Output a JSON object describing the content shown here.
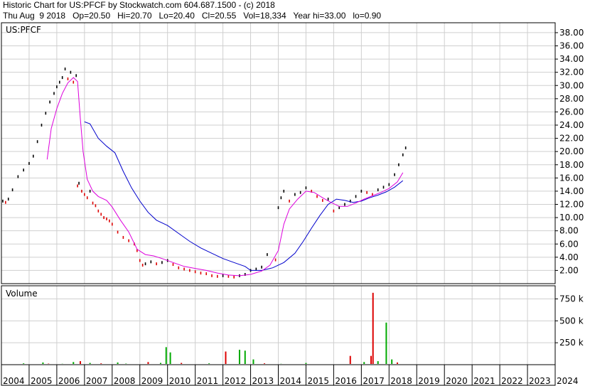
{
  "header": {
    "line1": "Historic Chart for US:PFCF by Stockwatch.com 604.687.1500 - (c) 2018",
    "line2": "Thu Aug  9 2018   Op=20.50   Hi=20.70   Lo=20.40   Cl=20.55   Vol=18,334   Year hi=33.00   lo=0.90"
  },
  "price_panel": {
    "symbol_label": "US:PFCF"
  },
  "volume_panel": {
    "title": "Volume"
  },
  "colors": {
    "bar_up": "#000000",
    "bar_down": "#dd0000",
    "ma_short": "#dd00dd",
    "ma_long": "#0000cc",
    "vol_up": "#00aa00",
    "vol_down": "#dd0000",
    "grid": "#cfcfcf",
    "frame": "#000000"
  },
  "chart_data": [
    {
      "type": "line",
      "panel": "price",
      "y_ticks": [
        "2.00",
        "4.00",
        "6.00",
        "8.00",
        "10.00",
        "12.00",
        "14.00",
        "16.00",
        "18.00",
        "20.00",
        "22.00",
        "24.00",
        "26.00",
        "28.00",
        "30.00",
        "32.00",
        "34.00",
        "36.00",
        "38.00"
      ],
      "ylim": [
        0,
        39.5
      ],
      "x_ticks": [
        "2004",
        "2005",
        "2006",
        "2007",
        "2008",
        "2009",
        "2010",
        "2011",
        "2012",
        "2013",
        "2014",
        "2015",
        "2016",
        "2017",
        "2018",
        "2019",
        "2020",
        "2021",
        "2022",
        "2023",
        "2024"
      ],
      "xlim": [
        2004.0,
        2024.0
      ],
      "price_points": [
        [
          2004.05,
          12.5
        ],
        [
          2004.15,
          12.3
        ],
        [
          2004.25,
          12.8
        ],
        [
          2004.4,
          14.2
        ],
        [
          2004.6,
          16.2
        ],
        [
          2004.8,
          17.2
        ],
        [
          2005.0,
          18.2
        ],
        [
          2005.15,
          19.3
        ],
        [
          2005.3,
          21.5
        ],
        [
          2005.45,
          24.0
        ],
        [
          2005.6,
          25.8
        ],
        [
          2005.75,
          27.5
        ],
        [
          2005.9,
          28.8
        ],
        [
          2006.0,
          29.8
        ],
        [
          2006.1,
          30.5
        ],
        [
          2006.2,
          31.2
        ],
        [
          2006.3,
          32.5
        ],
        [
          2006.4,
          31.0
        ],
        [
          2006.5,
          32.0
        ],
        [
          2006.6,
          30.5
        ],
        [
          2006.7,
          31.5
        ],
        [
          2006.75,
          14.8
        ],
        [
          2006.8,
          15.2
        ],
        [
          2006.9,
          14.0
        ],
        [
          2007.0,
          13.5
        ],
        [
          2007.1,
          13.0
        ],
        [
          2007.2,
          14.0
        ],
        [
          2007.3,
          12.2
        ],
        [
          2007.4,
          11.8
        ],
        [
          2007.5,
          11.0
        ],
        [
          2007.6,
          10.5
        ],
        [
          2007.7,
          10.0
        ],
        [
          2007.8,
          9.8
        ],
        [
          2007.9,
          9.5
        ],
        [
          2008.0,
          9.0
        ],
        [
          2008.2,
          7.8
        ],
        [
          2008.4,
          7.0
        ],
        [
          2008.6,
          6.5
        ],
        [
          2008.8,
          6.0
        ],
        [
          2008.9,
          5.0
        ],
        [
          2009.0,
          3.5
        ],
        [
          2009.1,
          2.8
        ],
        [
          2009.2,
          3.0
        ],
        [
          2009.4,
          3.3
        ],
        [
          2009.6,
          3.0
        ],
        [
          2009.8,
          3.2
        ],
        [
          2010.0,
          3.5
        ],
        [
          2010.2,
          2.9
        ],
        [
          2010.4,
          2.4
        ],
        [
          2010.6,
          2.2
        ],
        [
          2010.8,
          2.0
        ],
        [
          2011.0,
          1.8
        ],
        [
          2011.2,
          1.6
        ],
        [
          2011.4,
          1.5
        ],
        [
          2011.6,
          1.2
        ],
        [
          2011.8,
          1.1
        ],
        [
          2012.0,
          1.2
        ],
        [
          2012.2,
          1.1
        ],
        [
          2012.4,
          1.0
        ],
        [
          2012.6,
          1.2
        ],
        [
          2012.8,
          1.4
        ],
        [
          2013.0,
          2.0
        ],
        [
          2013.2,
          2.2
        ],
        [
          2013.4,
          2.5
        ],
        [
          2013.6,
          4.4
        ],
        [
          2013.9,
          3.6
        ],
        [
          2014.0,
          11.5
        ],
        [
          2014.1,
          13.0
        ],
        [
          2014.2,
          14.0
        ],
        [
          2014.4,
          12.5
        ],
        [
          2014.6,
          13.5
        ],
        [
          2014.8,
          13.8
        ],
        [
          2015.0,
          14.5
        ],
        [
          2015.2,
          14.0
        ],
        [
          2015.4,
          13.2
        ],
        [
          2015.6,
          12.6
        ],
        [
          2015.8,
          12.8
        ],
        [
          2016.0,
          11.0
        ],
        [
          2016.2,
          11.5
        ],
        [
          2016.4,
          12.0
        ],
        [
          2016.6,
          12.5
        ],
        [
          2016.8,
          13.2
        ],
        [
          2017.0,
          14.0
        ],
        [
          2017.2,
          13.8
        ],
        [
          2017.4,
          13.5
        ],
        [
          2017.6,
          14.2
        ],
        [
          2017.8,
          14.6
        ],
        [
          2018.0,
          15.0
        ],
        [
          2018.2,
          16.5
        ],
        [
          2018.35,
          18.0
        ],
        [
          2018.5,
          19.5
        ],
        [
          2018.6,
          20.55
        ]
      ],
      "ma_short": [
        [
          2005.65,
          18.8
        ],
        [
          2005.8,
          23.5
        ],
        [
          2006.0,
          26.5
        ],
        [
          2006.2,
          28.8
        ],
        [
          2006.4,
          30.4
        ],
        [
          2006.6,
          31.2
        ],
        [
          2006.75,
          30.6
        ],
        [
          2006.85,
          25.0
        ],
        [
          2006.95,
          20.0
        ],
        [
          2007.1,
          15.8
        ],
        [
          2007.3,
          14.0
        ],
        [
          2007.5,
          13.2
        ],
        [
          2007.8,
          12.6
        ],
        [
          2008.0,
          11.6
        ],
        [
          2008.3,
          9.6
        ],
        [
          2008.6,
          7.8
        ],
        [
          2008.9,
          5.2
        ],
        [
          2009.2,
          4.4
        ],
        [
          2009.5,
          4.2
        ],
        [
          2009.8,
          3.8
        ],
        [
          2010.2,
          3.2
        ],
        [
          2010.6,
          2.6
        ],
        [
          2011.0,
          2.3
        ],
        [
          2011.4,
          2.0
        ],
        [
          2011.8,
          1.6
        ],
        [
          2012.2,
          1.3
        ],
        [
          2012.6,
          1.2
        ],
        [
          2013.0,
          1.4
        ],
        [
          2013.4,
          1.9
        ],
        [
          2013.7,
          2.8
        ],
        [
          2014.0,
          5.0
        ],
        [
          2014.2,
          9.0
        ],
        [
          2014.4,
          11.3
        ],
        [
          2014.7,
          12.8
        ],
        [
          2015.0,
          14.0
        ],
        [
          2015.3,
          13.8
        ],
        [
          2015.6,
          13.0
        ],
        [
          2015.9,
          12.3
        ],
        [
          2016.2,
          11.7
        ],
        [
          2016.5,
          11.7
        ],
        [
          2016.8,
          12.2
        ],
        [
          2017.1,
          12.8
        ],
        [
          2017.4,
          13.3
        ],
        [
          2017.7,
          13.8
        ],
        [
          2018.0,
          14.4
        ],
        [
          2018.3,
          15.4
        ],
        [
          2018.5,
          16.8
        ]
      ],
      "ma_long": [
        [
          2007.0,
          24.5
        ],
        [
          2007.2,
          24.2
        ],
        [
          2007.5,
          22.0
        ],
        [
          2007.8,
          20.8
        ],
        [
          2008.1,
          19.8
        ],
        [
          2008.4,
          17.0
        ],
        [
          2008.7,
          14.5
        ],
        [
          2009.0,
          12.5
        ],
        [
          2009.3,
          10.8
        ],
        [
          2009.6,
          9.6
        ],
        [
          2010.0,
          8.8
        ],
        [
          2010.4,
          7.6
        ],
        [
          2010.8,
          6.4
        ],
        [
          2011.2,
          5.4
        ],
        [
          2011.6,
          4.6
        ],
        [
          2012.0,
          3.8
        ],
        [
          2012.4,
          3.2
        ],
        [
          2012.8,
          2.6
        ],
        [
          2013.0,
          2.0
        ],
        [
          2013.4,
          2.0
        ],
        [
          2013.8,
          2.4
        ],
        [
          2014.2,
          3.2
        ],
        [
          2014.6,
          4.6
        ],
        [
          2014.9,
          6.4
        ],
        [
          2015.2,
          8.4
        ],
        [
          2015.5,
          10.3
        ],
        [
          2015.8,
          12.0
        ],
        [
          2016.1,
          12.8
        ],
        [
          2016.4,
          12.6
        ],
        [
          2016.7,
          12.3
        ],
        [
          2017.0,
          12.5
        ],
        [
          2017.3,
          13.0
        ],
        [
          2017.6,
          13.4
        ],
        [
          2017.9,
          13.9
        ],
        [
          2018.2,
          14.6
        ],
        [
          2018.5,
          15.6
        ]
      ]
    },
    {
      "type": "bar",
      "panel": "volume",
      "y_ticks": [
        "250 k",
        "500 k",
        "750 k"
      ],
      "ylim": [
        0,
        900
      ],
      "volume_bars": [
        [
          2004.8,
          15,
          "up"
        ],
        [
          2005.5,
          25,
          "up"
        ],
        [
          2005.7,
          12,
          "down"
        ],
        [
          2006.2,
          10,
          "up"
        ],
        [
          2006.6,
          30,
          "up"
        ],
        [
          2006.85,
          40,
          "down"
        ],
        [
          2007.2,
          20,
          "up"
        ],
        [
          2007.6,
          15,
          "down"
        ],
        [
          2008.2,
          25,
          "up"
        ],
        [
          2008.5,
          12,
          "up"
        ],
        [
          2009.3,
          30,
          "down"
        ],
        [
          2009.75,
          20,
          "up"
        ],
        [
          2009.95,
          200,
          "up"
        ],
        [
          2010.1,
          140,
          "up"
        ],
        [
          2010.5,
          20,
          "down"
        ],
        [
          2011.5,
          15,
          "up"
        ],
        [
          2012.1,
          150,
          "down"
        ],
        [
          2012.6,
          170,
          "up"
        ],
        [
          2012.8,
          160,
          "up"
        ],
        [
          2013.1,
          60,
          "up"
        ],
        [
          2013.5,
          15,
          "down"
        ],
        [
          2014.1,
          10,
          "up"
        ],
        [
          2015.0,
          20,
          "up"
        ],
        [
          2016.6,
          100,
          "down"
        ],
        [
          2017.1,
          30,
          "up"
        ],
        [
          2017.35,
          100,
          "down"
        ],
        [
          2017.42,
          820,
          "down"
        ],
        [
          2017.6,
          40,
          "up"
        ],
        [
          2017.9,
          480,
          "up"
        ],
        [
          2018.1,
          60,
          "up"
        ],
        [
          2018.3,
          25,
          "down"
        ]
      ]
    }
  ]
}
